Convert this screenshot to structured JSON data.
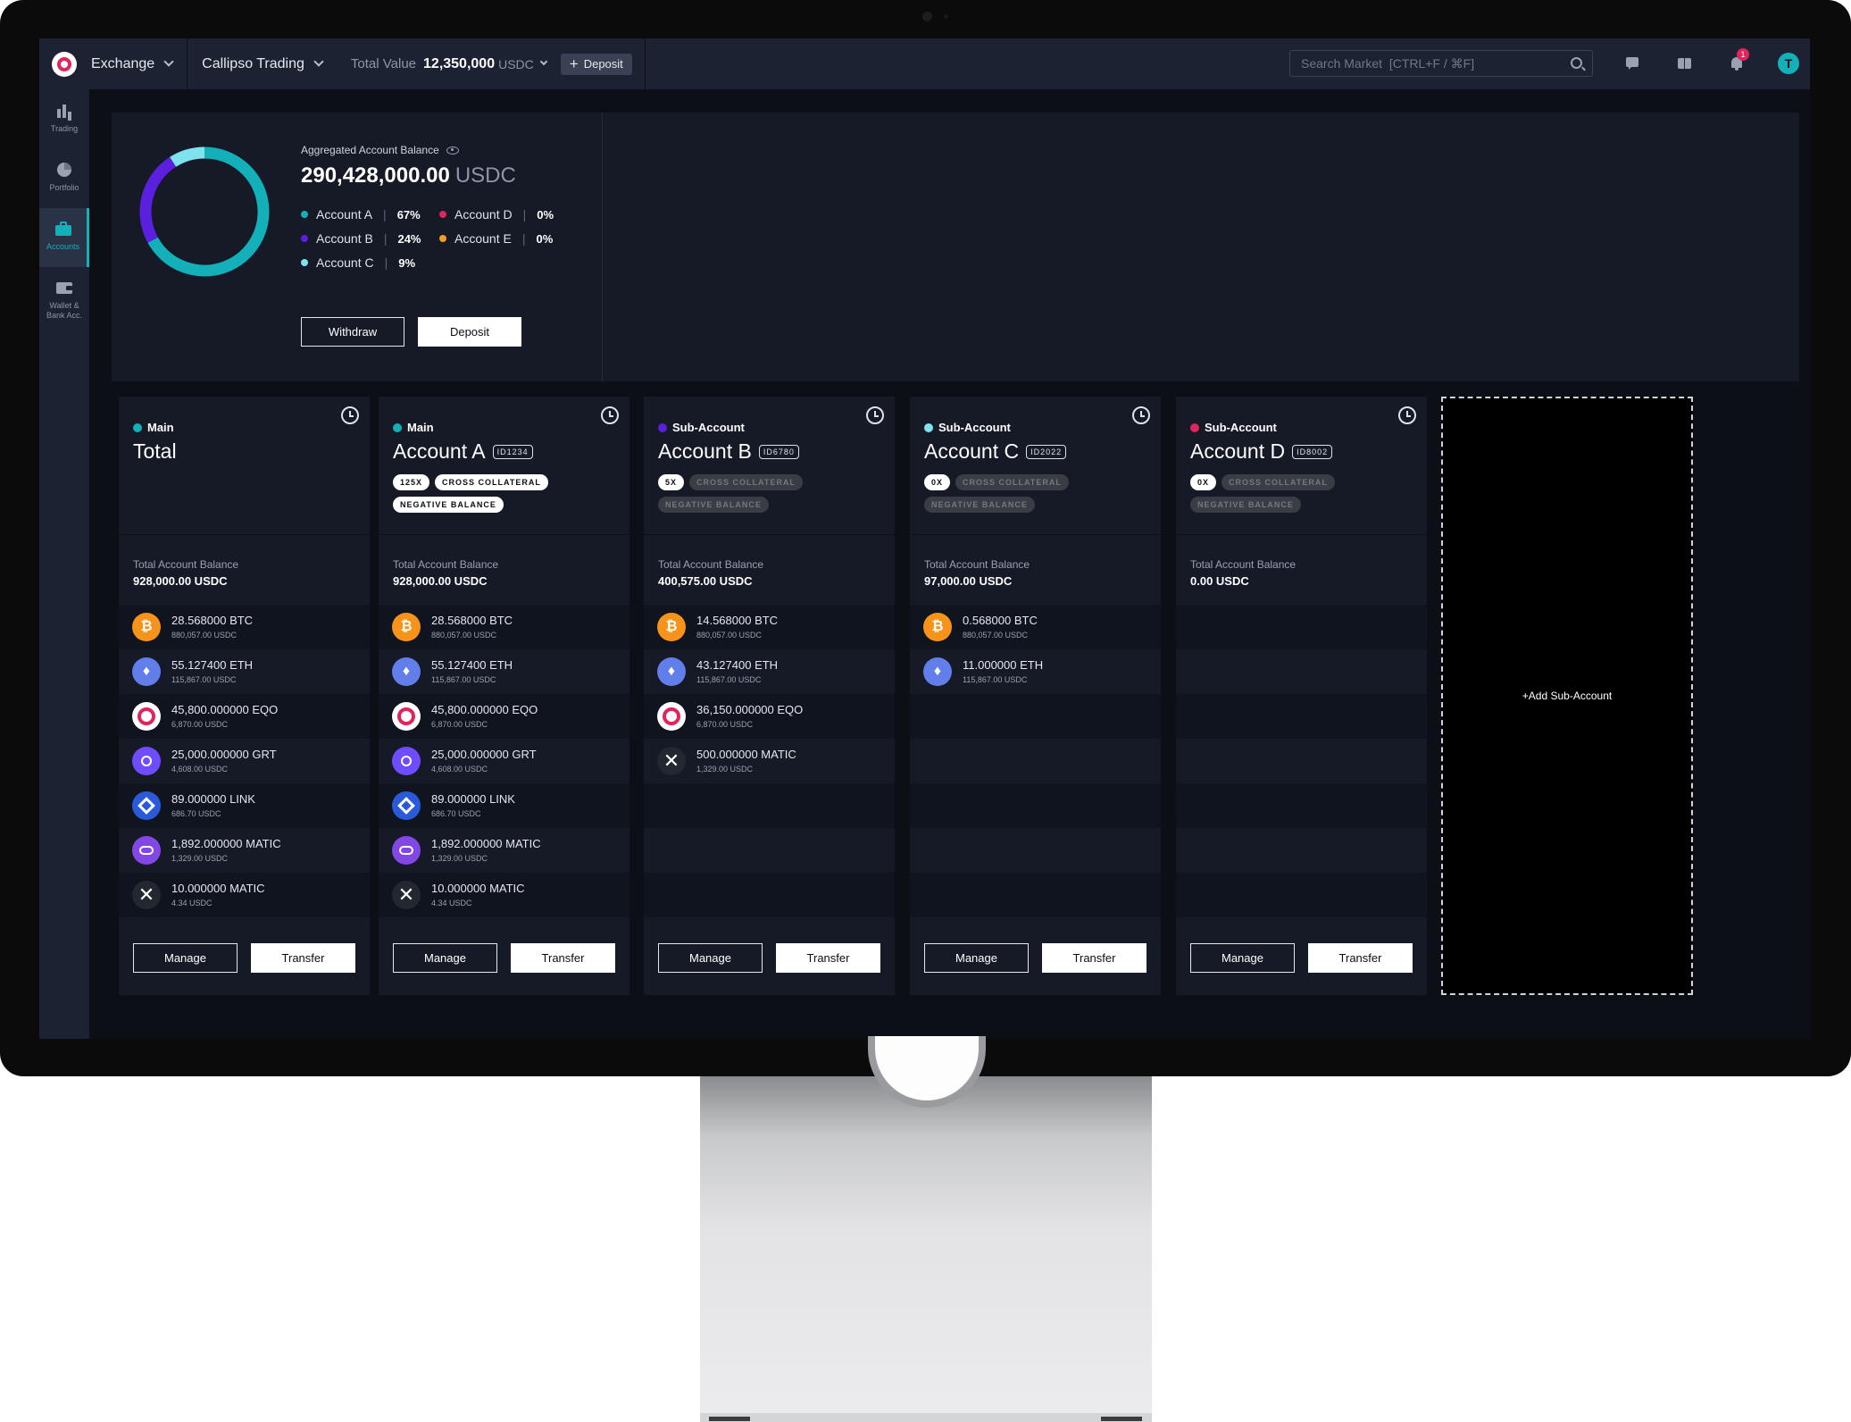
{
  "topbar": {
    "exchange_label": "Exchange",
    "workspace_label": "Callipso Trading",
    "total_value_label": "Total Value",
    "total_value": "12,350,000",
    "total_value_unit": "USDC",
    "deposit_label": "Deposit",
    "search_placeholder": "Search Market  [CTRL+F / ⌘F]",
    "notification_count": "1",
    "avatar_initial": "T"
  },
  "sidebar": {
    "items": [
      {
        "label": "Trading",
        "icon": "bar-chart-icon"
      },
      {
        "label": "Portfolio",
        "icon": "pie-chart-icon"
      },
      {
        "label": "Accounts",
        "icon": "briefcase-icon",
        "active": true
      },
      {
        "label": "Wallet & Bank Acc.",
        "icon": "wallet-icon"
      }
    ]
  },
  "summary": {
    "title": "Aggregated Account Balance",
    "value": "290,428,000.00",
    "unit": "USDC",
    "legend": [
      {
        "name": "Account A",
        "pct": "67%",
        "color": "#13b0b9"
      },
      {
        "name": "Account D",
        "pct": "0%",
        "color": "#e0245e"
      },
      {
        "name": "Account B",
        "pct": "24%",
        "color": "#5b1fe0"
      },
      {
        "name": "Account E",
        "pct": "0%",
        "color": "#f59e2a"
      },
      {
        "name": "Account C",
        "pct": "9%",
        "color": "#7fe3ef"
      }
    ],
    "withdraw_label": "Withdraw",
    "deposit_label": "Deposit"
  },
  "chart_data": {
    "type": "pie",
    "categories": [
      "Account A",
      "Account B",
      "Account C",
      "Account D",
      "Account E"
    ],
    "values": [
      67,
      24,
      9,
      0,
      0
    ],
    "colors": [
      "#13b0b9",
      "#5b1fe0",
      "#7fe3ef",
      "#e0245e",
      "#f59e2a"
    ]
  },
  "accounts": [
    {
      "type": "Main",
      "dot": "#13b0b9",
      "name": "Total",
      "id": "",
      "tags": [],
      "balance_label": "Total Account Balance",
      "balance": "928,000.00 USDC",
      "assets": [
        {
          "coin": "btc",
          "amount": "28.568000 BTC",
          "usdc": "880,057.00 USDC"
        },
        {
          "coin": "eth",
          "amount": "55.127400 ETH",
          "usdc": "115,867.00 USDC"
        },
        {
          "coin": "eqo",
          "amount": "45,800.000000 EQO",
          "usdc": "6,870.00 USDC"
        },
        {
          "coin": "grt",
          "amount": "25,000.000000 GRT",
          "usdc": "4,608.00 USDC"
        },
        {
          "coin": "link",
          "amount": "89.000000 LINK",
          "usdc": "686.70 USDC"
        },
        {
          "coin": "matic",
          "amount": "1,892.000000 MATIC",
          "usdc": "1,329.00 USDC"
        },
        {
          "coin": "xrp",
          "amount": "10.000000 MATIC",
          "usdc": "4.34 USDC"
        }
      ],
      "manage_label": "Manage",
      "transfer_label": "Transfer"
    },
    {
      "type": "Main",
      "dot": "#13b0b9",
      "name": "Account A",
      "id": "ID1234",
      "tags": [
        {
          "label": "125X",
          "on": true
        },
        {
          "label": "CROSS COLLATERAL",
          "on": true
        },
        {
          "label": "NEGATIVE BALANCE",
          "on": true
        }
      ],
      "balance_label": "Total Account Balance",
      "balance": "928,000.00 USDC",
      "assets": [
        {
          "coin": "btc",
          "amount": "28.568000 BTC",
          "usdc": "880,057.00 USDC"
        },
        {
          "coin": "eth",
          "amount": "55.127400 ETH",
          "usdc": "115,867.00 USDC"
        },
        {
          "coin": "eqo",
          "amount": "45,800.000000 EQO",
          "usdc": "6,870.00 USDC"
        },
        {
          "coin": "grt",
          "amount": "25,000.000000 GRT",
          "usdc": "4,608.00 USDC"
        },
        {
          "coin": "link",
          "amount": "89.000000 LINK",
          "usdc": "686.70 USDC"
        },
        {
          "coin": "matic",
          "amount": "1,892.000000 MATIC",
          "usdc": "1,329.00 USDC"
        },
        {
          "coin": "xrp",
          "amount": "10.000000 MATIC",
          "usdc": "4.34 USDC"
        }
      ],
      "manage_label": "Manage",
      "transfer_label": "Transfer"
    },
    {
      "type": "Sub-Account",
      "dot": "#5b1fe0",
      "name": "Account B",
      "id": "ID6780",
      "tags": [
        {
          "label": "5X",
          "on": true
        },
        {
          "label": "CROSS COLLATERAL",
          "on": false
        },
        {
          "label": "NEGATIVE BALANCE",
          "on": false
        }
      ],
      "balance_label": "Total Account Balance",
      "balance": "400,575.00 USDC",
      "assets": [
        {
          "coin": "btc",
          "amount": "14.568000 BTC",
          "usdc": "880,057.00 USDC"
        },
        {
          "coin": "eth",
          "amount": "43.127400 ETH",
          "usdc": "115,867.00 USDC"
        },
        {
          "coin": "eqo",
          "amount": "36,150.000000 EQO",
          "usdc": "6,870.00 USDC"
        },
        {
          "coin": "xrp",
          "amount": "500.000000 MATIC",
          "usdc": "1,329.00 USDC"
        }
      ],
      "manage_label": "Manage",
      "transfer_label": "Transfer"
    },
    {
      "type": "Sub-Account",
      "dot": "#7fe3ef",
      "name": "Account C",
      "id": "ID2022",
      "tags": [
        {
          "label": "0X",
          "on": true
        },
        {
          "label": "CROSS COLLATERAL",
          "on": false
        },
        {
          "label": "NEGATIVE BALANCE",
          "on": false
        }
      ],
      "balance_label": "Total Account Balance",
      "balance": "97,000.00 USDC",
      "assets": [
        {
          "coin": "btc",
          "amount": "0.568000 BTC",
          "usdc": "880,057.00 USDC"
        },
        {
          "coin": "eth",
          "amount": "11.000000 ETH",
          "usdc": "115,867.00 USDC"
        }
      ],
      "manage_label": "Manage",
      "transfer_label": "Transfer"
    },
    {
      "type": "Sub-Account",
      "dot": "#e0245e",
      "name": "Account D",
      "id": "ID8002",
      "tags": [
        {
          "label": "0X",
          "on": true
        },
        {
          "label": "CROSS COLLATERAL",
          "on": false
        },
        {
          "label": "NEGATIVE BALANCE",
          "on": false
        }
      ],
      "balance_label": "Total Account Balance",
      "balance": "0.00 USDC",
      "assets": [],
      "manage_label": "Manage",
      "transfer_label": "Transfer"
    }
  ],
  "add_sub_account_label": "+Add Sub-Account"
}
